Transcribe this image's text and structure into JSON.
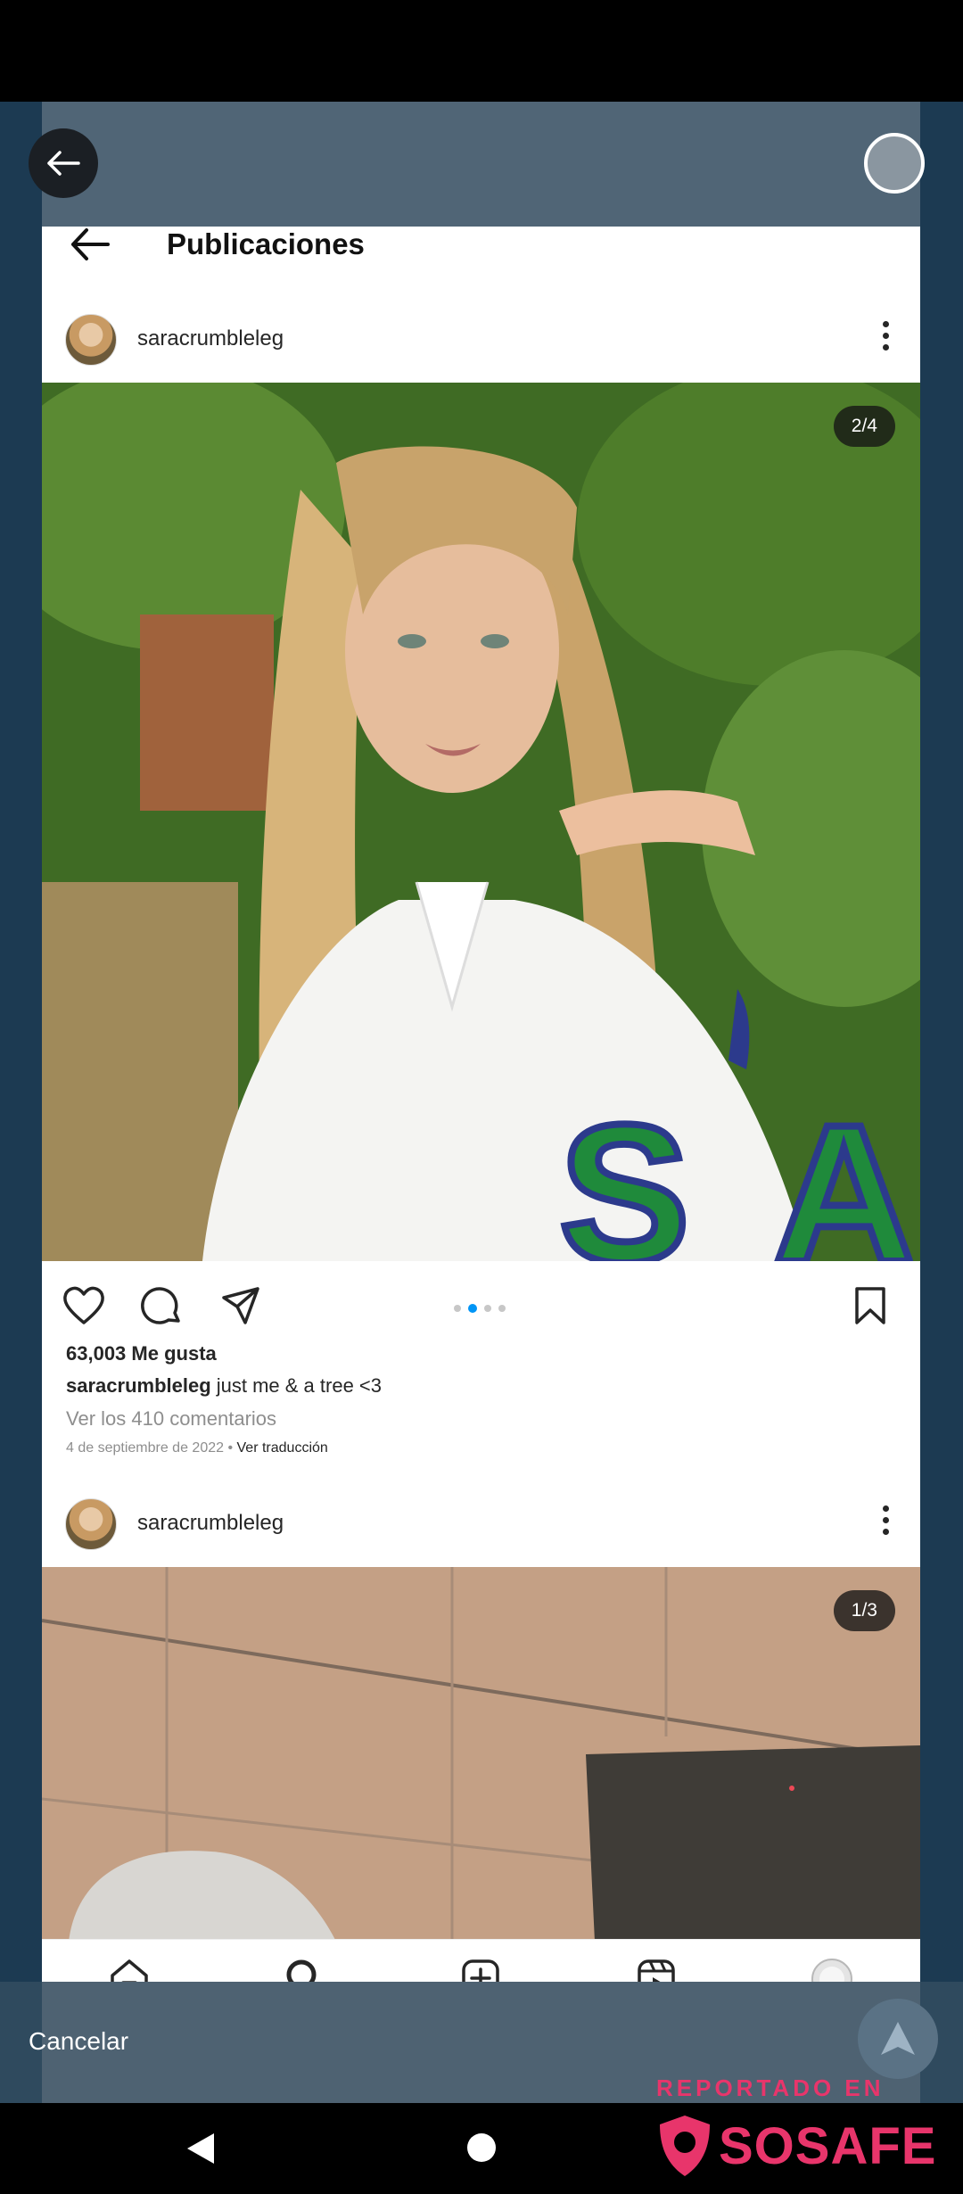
{
  "overlay": {
    "cancel_label": "Cancelar"
  },
  "instagram": {
    "header_title": "Publicaciones",
    "posts": [
      {
        "username": "saracrumbleleg",
        "carousel_badge": "2/4",
        "likes": "63,003 Me gusta",
        "caption_user": "saracrumbleleg",
        "caption_text": " just me & a tree <3",
        "comments_link": "Ver los 410 comentarios",
        "date": "4 de septiembre de 2022",
        "separator": " • ",
        "translate_link": "Ver traducción"
      },
      {
        "username": "saracrumbleleg",
        "carousel_badge": "1/3"
      }
    ],
    "nav": [
      "home-icon",
      "search-icon",
      "new-post-icon",
      "reels-icon",
      "profile-avatar"
    ]
  },
  "watermark": {
    "caption": "REPORTADO EN",
    "brand": "SOSAFE"
  },
  "colors": {
    "accent_blue": "#0095f6",
    "watermark_pink": "#e8356b",
    "overlay_teal": "#1c3a52"
  }
}
